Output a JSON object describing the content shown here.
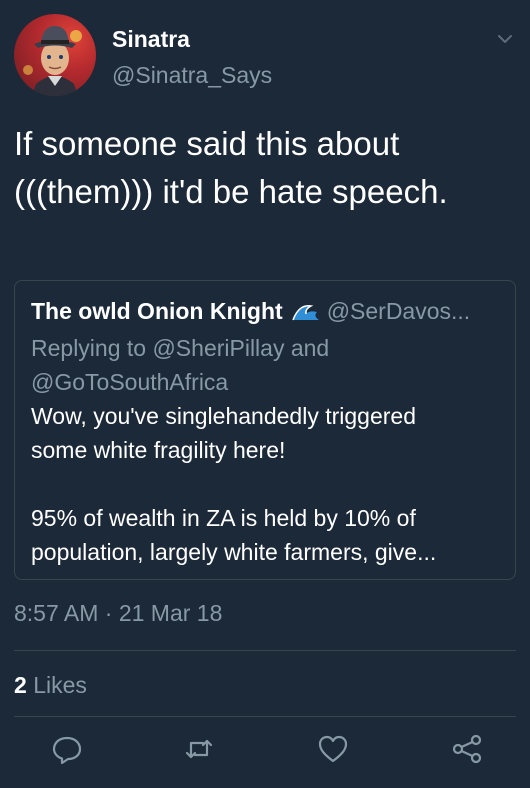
{
  "tweet": {
    "author": {
      "display_name": "Sinatra",
      "handle": "@Sinatra_Says",
      "avatar_icon": "sinatra-avatar"
    },
    "text": "If someone said this about (((them))) it'd be hate speech.",
    "timestamp": "8:57 AM · 21 Mar 18",
    "likes": {
      "count": "2",
      "label": "Likes"
    }
  },
  "quoted_tweet": {
    "display_name": "The owld Onion Knight",
    "emoji_icon": "wave-icon",
    "handle": "@SerDavos...",
    "reply_line_1": "Replying to @SheriPillay and",
    "reply_line_2": "@GoToSouthAfrica",
    "body_line_1": "Wow, you've singlehandedly triggered",
    "body_line_2": "some white fragility here!",
    "body_line_3": "95% of wealth in ZA is held by 10% of",
    "body_line_4": "population, largely white farmers, give..."
  },
  "actions": [
    "reply-icon",
    "retweet-icon",
    "like-icon",
    "share-icon"
  ],
  "colors": {
    "background": "#1c2938",
    "text": "#ffffff",
    "secondary_text": "#8899a6",
    "border": "#38444d"
  }
}
